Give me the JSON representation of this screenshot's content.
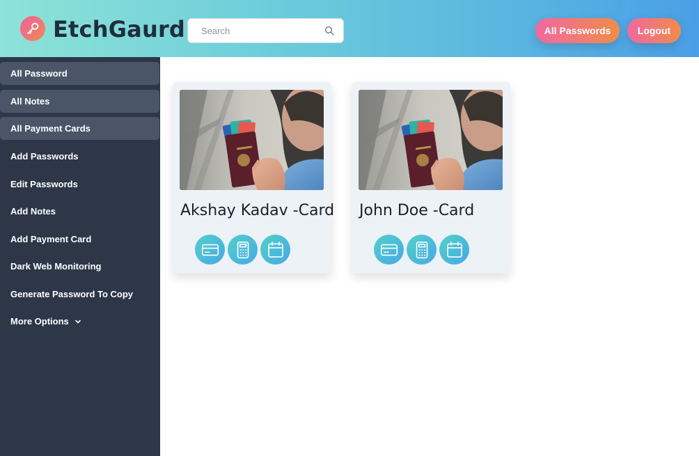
{
  "header": {
    "brand": "EtchGaurd",
    "logo_icon": "key-icon",
    "search_placeholder": "Search",
    "all_passwords_label": "All Passwords",
    "logout_label": "Logout"
  },
  "sidebar": {
    "items": [
      {
        "label": "All Password",
        "active": true
      },
      {
        "label": "All Notes",
        "active": true
      },
      {
        "label": "All Payment Cards",
        "active": true
      },
      {
        "label": "Add Passwords",
        "active": false
      },
      {
        "label": "Edit Passwords",
        "active": false
      },
      {
        "label": "Add Notes",
        "active": false
      },
      {
        "label": "Add Payment Card",
        "active": false
      },
      {
        "label": "Dark Web Monitoring",
        "active": false
      },
      {
        "label": "Generate Password To Copy",
        "active": false
      },
      {
        "label": "More Options",
        "active": false
      }
    ]
  },
  "cards": [
    {
      "title": "Akshay Kadav -Card",
      "image": "passport-with-cards-photo",
      "actions": [
        "credit-card-icon",
        "calculator-icon",
        "calendar-icon"
      ]
    },
    {
      "title": "John Doe -Card",
      "image": "passport-with-cards-photo",
      "actions": [
        "credit-card-icon",
        "calculator-icon",
        "calendar-icon"
      ]
    }
  ],
  "colors": {
    "header_gradient": [
      "#8ee3d8",
      "#4a9fe6"
    ],
    "button_gradient": [
      "#f068a0",
      "#f08c4a"
    ],
    "sidebar_bg": "#2d3748",
    "sidebar_active_bg": "#4a5568",
    "card_bg": "#edf2f7",
    "icon_gradient": [
      "#52d0c8",
      "#47a9e6"
    ]
  }
}
